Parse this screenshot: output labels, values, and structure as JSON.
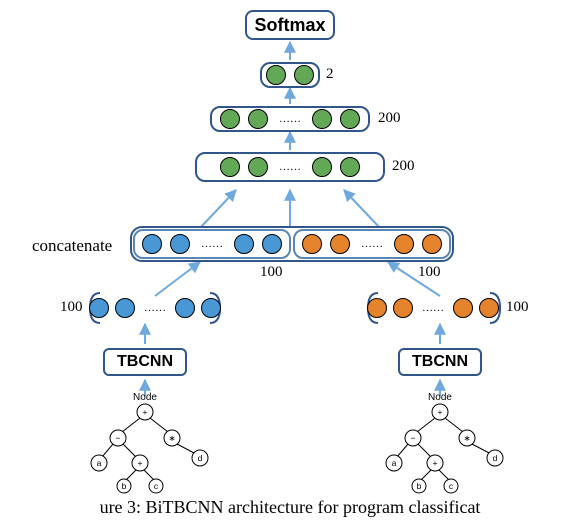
{
  "softmax": {
    "label": "Softmax"
  },
  "layers": {
    "out": {
      "size": "2"
    },
    "fc1": {
      "size": "200",
      "dots": "……"
    },
    "fc2": {
      "size": "200",
      "dots": "……"
    },
    "concat_label": "concatenate",
    "concat_left": {
      "size": "100",
      "dots": "……"
    },
    "concat_right": {
      "size": "100",
      "dots": "……"
    },
    "enc_left": {
      "size": "100",
      "dots": "……"
    },
    "enc_right": {
      "size": "100",
      "dots": "……"
    }
  },
  "tbcnn": {
    "left": "TBCNN",
    "right": "TBCNN"
  },
  "tree": {
    "heading": "Node",
    "root": "+",
    "l1l": "−",
    "l1r": "∗",
    "a": "a",
    "b": "b",
    "c": "c",
    "d": "d",
    "plus": "+"
  },
  "caption": "ure 3: BiTBCNN architecture for program classificat"
}
